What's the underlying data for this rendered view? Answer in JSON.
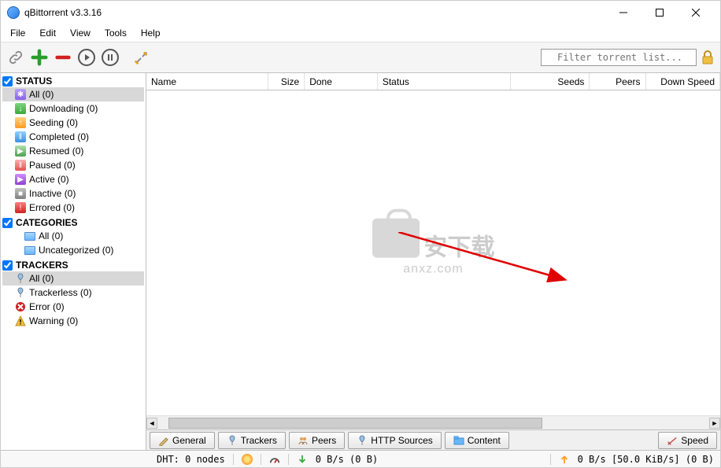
{
  "window": {
    "title": "qBittorrent v3.3.16"
  },
  "menubar": [
    "File",
    "Edit",
    "View",
    "Tools",
    "Help"
  ],
  "toolbar": {
    "filter_placeholder": "Filter torrent list..."
  },
  "sidebar": {
    "status": {
      "heading": "STATUS",
      "items": [
        {
          "label": "All (0)",
          "icon": "status-all",
          "glyph": "✱",
          "selected": true
        },
        {
          "label": "Downloading (0)",
          "icon": "status-down",
          "glyph": "↓"
        },
        {
          "label": "Seeding (0)",
          "icon": "status-seed",
          "glyph": "↑"
        },
        {
          "label": "Completed (0)",
          "icon": "status-comp",
          "glyph": "‖"
        },
        {
          "label": "Resumed (0)",
          "icon": "status-res",
          "glyph": "▶"
        },
        {
          "label": "Paused (0)",
          "icon": "status-paused",
          "glyph": "‖"
        },
        {
          "label": "Active (0)",
          "icon": "status-active",
          "glyph": "▶"
        },
        {
          "label": "Inactive (0)",
          "icon": "status-inactive",
          "glyph": "■"
        },
        {
          "label": "Errored (0)",
          "icon": "status-err",
          "glyph": "!"
        }
      ]
    },
    "categories": {
      "heading": "CATEGORIES",
      "items": [
        {
          "label": "All (0)"
        },
        {
          "label": "Uncategorized (0)"
        }
      ]
    },
    "trackers": {
      "heading": "TRACKERS",
      "items": [
        {
          "label": "All (0)",
          "icon": "tracker-pin",
          "selected": true
        },
        {
          "label": "Trackerless (0)",
          "icon": "tracker-pin"
        },
        {
          "label": "Error (0)",
          "icon": "tracker-error"
        },
        {
          "label": "Warning (0)",
          "icon": "tracker-warn"
        }
      ]
    }
  },
  "grid": {
    "columns": [
      "Name",
      "Size",
      "Done",
      "Status",
      "Seeds",
      "Peers",
      "Down Speed"
    ]
  },
  "bottom_tabs": [
    {
      "label": "General",
      "icon": "pen"
    },
    {
      "label": "Trackers",
      "icon": "pin"
    },
    {
      "label": "Peers",
      "icon": "peers"
    },
    {
      "label": "HTTP Sources",
      "icon": "pin"
    },
    {
      "label": "Content",
      "icon": "folder"
    }
  ],
  "speed_tab": "Speed",
  "statusbar": {
    "dht": "DHT: 0 nodes",
    "down": "0  B/s (0  B)",
    "up": "0  B/s [50.0  KiB/s] (0  B)"
  },
  "watermark": {
    "zh": "安下载",
    "url": "anxz.com"
  }
}
